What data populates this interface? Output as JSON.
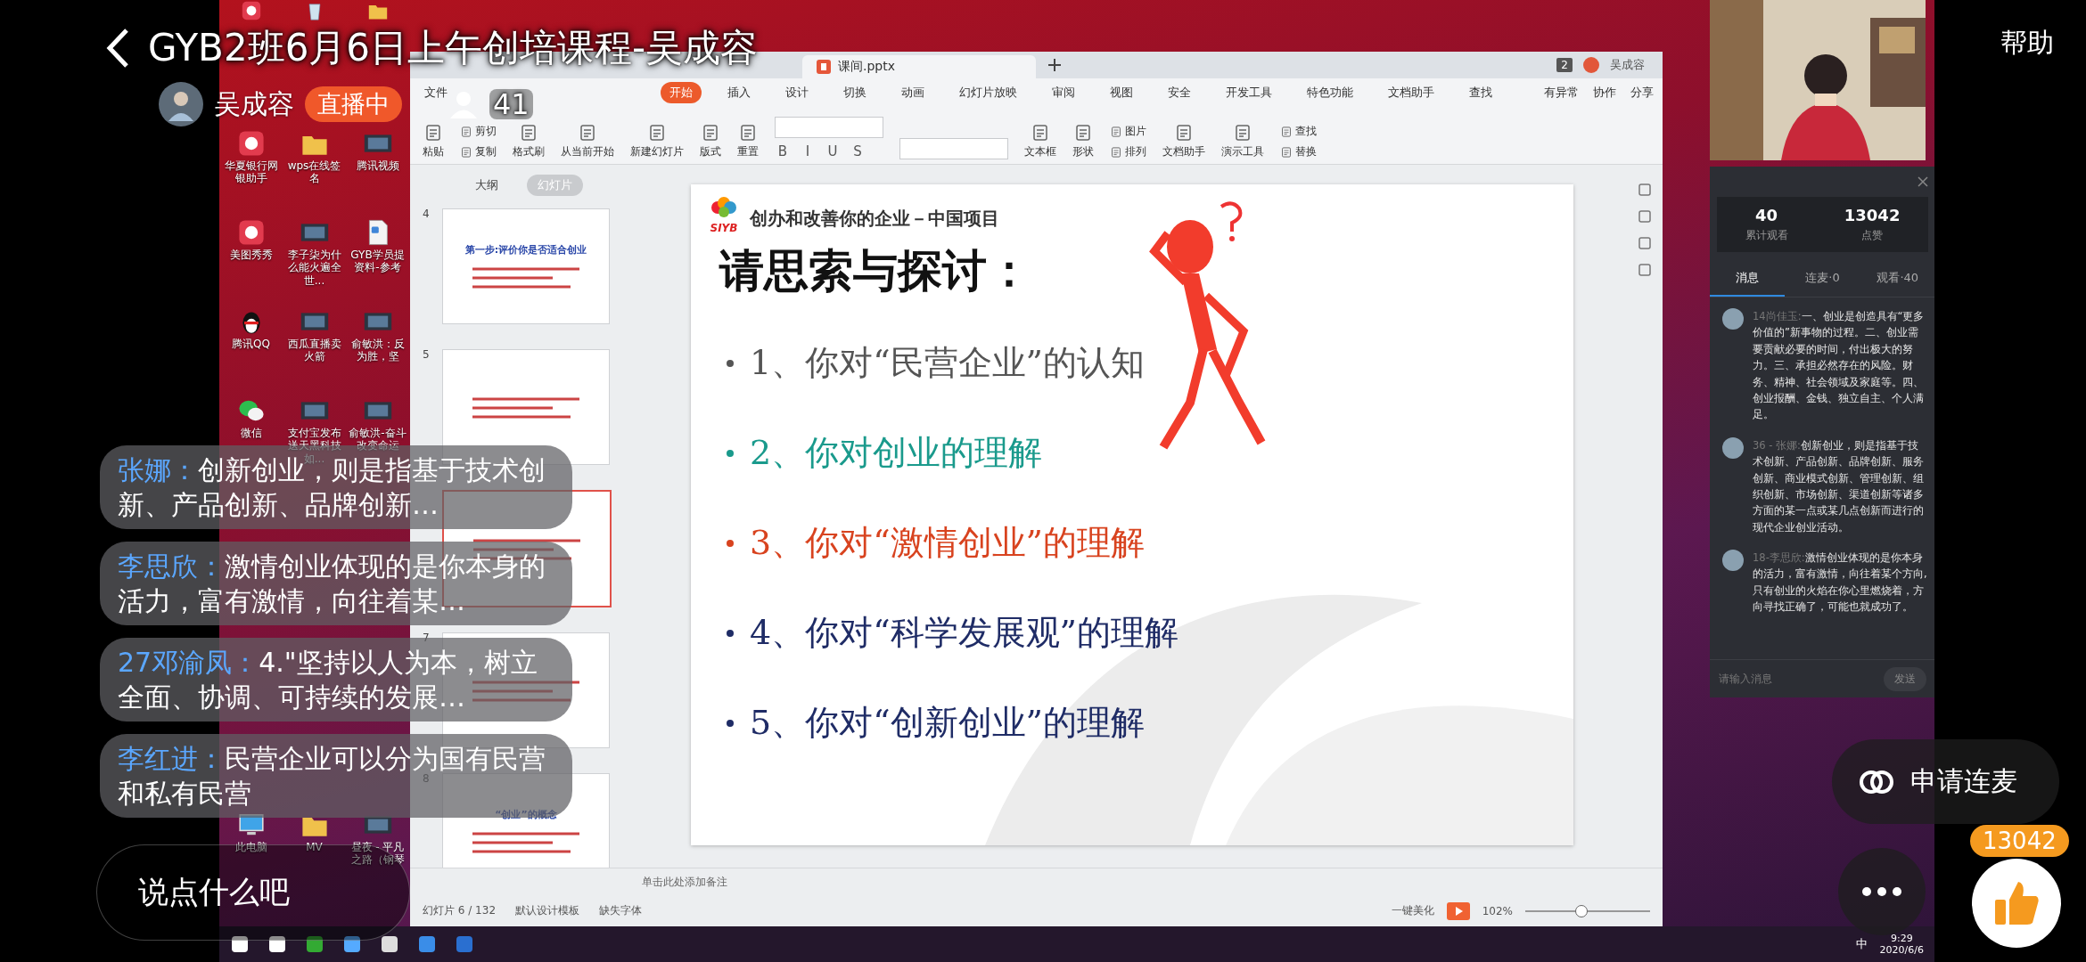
{
  "stream": {
    "title": "GYB2班6月6日上午创培课程-吴成容",
    "host": "吴成容",
    "live_badge": "直播中",
    "viewers": "41",
    "help": "帮助"
  },
  "desktop_icons": [
    [
      {
        "kind": "app"
      },
      {
        "kind": "bin"
      },
      {
        "kind": "folder"
      }
    ],
    [
      {
        "kind": "app",
        "label": "华夏银行网银助手"
      },
      {
        "kind": "folder",
        "label": "wps在线签名"
      },
      {
        "kind": "video",
        "label": "腾讯视频"
      }
    ],
    [
      {
        "kind": "app",
        "label": "美图秀秀"
      },
      {
        "kind": "video",
        "label": "李子柒为什么能火遍全世..."
      },
      {
        "kind": "file",
        "label": "GYB学员提资料-参考"
      }
    ],
    [
      {
        "kind": "penguin",
        "label": "腾讯QQ"
      },
      {
        "kind": "video",
        "label": "西瓜直播卖火箭"
      },
      {
        "kind": "video",
        "label": "俞敏洪：反为胜，坚"
      }
    ],
    [
      {
        "kind": "chat",
        "label": "微信"
      },
      {
        "kind": "video",
        "label": "支付宝发布送天黑科技如..."
      },
      {
        "kind": "video",
        "label": "俞敏洪-奋斗改变命运"
      }
    ],
    [
      {
        "kind": "computer",
        "label": "此电脑"
      },
      {
        "kind": "folder",
        "label": "MV"
      },
      {
        "kind": "video",
        "label": "昼夜 - 平凡之路（钢琴"
      }
    ]
  ],
  "wps": {
    "tabs": [
      {
        "label": "课间.pptx",
        "selected": true
      }
    ],
    "window_count": "2",
    "user": "吴成容",
    "menu": [
      {
        "label": "文件",
        "selected": false
      },
      {
        "label": "开始",
        "selected": true
      },
      {
        "label": "插入",
        "selected": false
      },
      {
        "label": "设计",
        "selected": false
      },
      {
        "label": "切换",
        "selected": false
      },
      {
        "label": "动画",
        "selected": false
      },
      {
        "label": "幻灯片放映",
        "selected": false
      },
      {
        "label": "审阅",
        "selected": false
      },
      {
        "label": "视图",
        "selected": false
      },
      {
        "label": "安全",
        "selected": false
      },
      {
        "label": "开发工具",
        "selected": false
      },
      {
        "label": "特色功能",
        "selected": false
      },
      {
        "label": "文档助手",
        "selected": false
      },
      {
        "label": "查找",
        "selected": false
      }
    ],
    "menu_right": [
      "有异常",
      "协作",
      "分享"
    ],
    "toolbar_left": [
      [
        {
          "label": "粘贴"
        }
      ],
      [
        {
          "label": "剪切"
        },
        {
          "label": "复制"
        }
      ],
      [
        {
          "label": "格式刷"
        }
      ],
      [
        {
          "label": "从当前开始"
        }
      ],
      [
        {
          "label": "新建幻灯片"
        }
      ],
      [
        {
          "label": "版式"
        }
      ],
      [
        {
          "label": "重置"
        }
      ]
    ],
    "format_buttons": [
      "B",
      "I",
      "U",
      "S"
    ],
    "toolbar_right": [
      [
        {
          "label": "文本框"
        }
      ],
      [
        {
          "label": "形状"
        }
      ],
      [
        {
          "label": "图片"
        },
        {
          "label": "排列"
        }
      ],
      [
        {
          "label": "文档助手"
        }
      ],
      [
        {
          "label": "演示工具"
        }
      ],
      [
        {
          "label": "查找"
        },
        {
          "label": "替换"
        }
      ]
    ],
    "panel_tabs": [
      {
        "label": "大纲",
        "selected": false
      },
      {
        "label": "幻灯片",
        "selected": true
      }
    ],
    "thumbnails": [
      {
        "number": "4",
        "title": "第一步:评价你是否适合创业",
        "selected": false
      },
      {
        "number": "5",
        "selected": false
      },
      {
        "selected": true
      },
      {
        "number": "7",
        "selected": false
      },
      {
        "number": "8",
        "title": "“创业”的概念",
        "selected": false
      }
    ],
    "slide": {
      "logo": "SIYB",
      "header": "创办和改善你的企业－中国项目",
      "title": "请思索与探讨：",
      "bullets": [
        {
          "text": "1、你对“民营企业”的认知",
          "color": "#555555"
        },
        {
          "text": "2、你对创业的理解",
          "color": "#1a9a8c"
        },
        {
          "text": "3、你对“激情创业”的理解",
          "color": "#d8431f"
        },
        {
          "text": "4、你对“科学发展观”的理解",
          "color": "#1f2c66"
        },
        {
          "text": "5、你对“创新创业”的理解",
          "color": "#1f2c66"
        }
      ]
    },
    "notes_placeholder": "单击此处添加备注",
    "status": {
      "slide": "幻灯片 6 / 132",
      "template": "默认设计模板",
      "font": "缺失字体",
      "beautify": "一键美化",
      "zoom": "102%",
      "level": 0.45
    }
  },
  "live_panel": {
    "stats": [
      {
        "value": "40",
        "label": "累计观看"
      },
      {
        "value": "13042",
        "label": "点赞"
      }
    ],
    "tabs": [
      {
        "label": "消息",
        "selected": true
      },
      {
        "label": "连麦·0",
        "selected": false
      },
      {
        "label": "观看·40",
        "selected": false
      }
    ],
    "messages": [
      {
        "name": "14尚佳玉:",
        "text": "一、创业是创造具有“更多价值的”新事物的过程。二、创业需要贡献必要的时间，付出极大的努力。三、承担必然存在的风险。财务、精神、社会领域及家庭等。四、创业报酬、金钱、独立自主、个人满足。"
      },
      {
        "name": "36 - 张娜:",
        "text": "创新创业，则是指基于技术创新、产品创新、品牌创新、服务创新、商业模式创新、管理创新、组织创新、市场创新、渠道创新等诸多方面的某一点或某几点创新而进行的现代企业创业活动。"
      },
      {
        "name": "18-李思欣:",
        "text": "激情创业体现的是你本身的活力，富有激情，向往着某个方向,只有创业的火焰在你心里燃烧着，方向寻找正确了，可能也就成功了。"
      }
    ],
    "input_placeholder": "请输入消息",
    "send": "发送"
  },
  "taskbar": {
    "ime": "中",
    "time": "9:29",
    "date": "2020/6/6"
  },
  "comments": [
    {
      "user": "张娜：",
      "text": "创新创业，则是指基于技术创新、产品创新、品牌创新…"
    },
    {
      "user": "李思欣：",
      "text": "激情创业体现的是你本身的活力，富有激情，向往着某…"
    },
    {
      "user": "27邓渝凤：",
      "text": "4.\"坚持以人为本，树立全面、协调、可持续的发展…"
    },
    {
      "user": "李红进：",
      "text": "民营企业可以分为国有民营和私有民营"
    }
  ],
  "bottom": {
    "comment_placeholder": "说点什么吧",
    "co_stream": "申请连麦",
    "likes": "13042"
  }
}
